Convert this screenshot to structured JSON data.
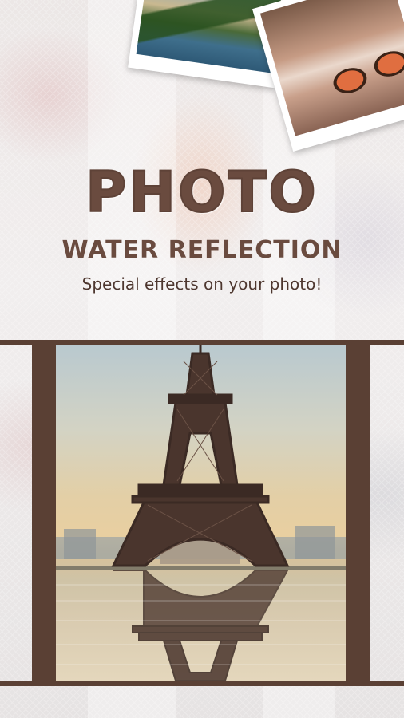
{
  "headline": {
    "title": "PHOTO",
    "subtitle": "WATER REFLECTION",
    "tagline": "Special effects on your photo!"
  },
  "colors": {
    "brand_brown": "#5a4034",
    "text_brown": "#6a4b3f",
    "background": "#efeceb"
  },
  "images": {
    "polaroid_1": "landscape-photo",
    "polaroid_2": "sunglasses-photo",
    "main_photo": "eiffel-tower-water-reflection"
  }
}
